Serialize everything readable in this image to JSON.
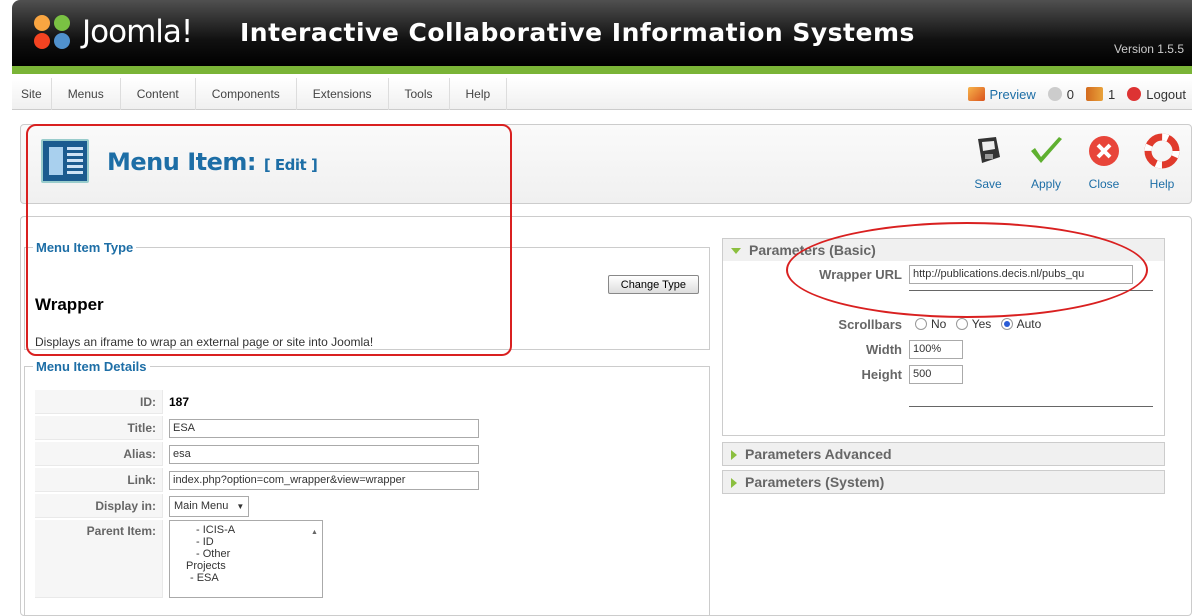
{
  "header": {
    "logo_text": "Joomla!",
    "logo_sup": "®",
    "site_title": "Interactive Collaborative Information Systems",
    "version": "Version 1.5.5"
  },
  "menu": {
    "items": [
      "Site",
      "Menus",
      "Content",
      "Components",
      "Extensions",
      "Tools",
      "Help"
    ]
  },
  "status": {
    "preview": "Preview",
    "messages": "0",
    "users": "1",
    "logout": "Logout"
  },
  "toolbar": {
    "title": "Menu Item:",
    "subtitle": "[ Edit ]",
    "buttons": {
      "save": "Save",
      "apply": "Apply",
      "close": "Close",
      "help": "Help"
    }
  },
  "menu_item_type": {
    "legend": "Menu Item Type",
    "change_type": "Change Type",
    "name": "Wrapper",
    "description": "Displays an iframe to wrap an external page or site into Joomla!"
  },
  "details": {
    "legend": "Menu Item Details",
    "id_label": "ID:",
    "id_value": "187",
    "title_label": "Title:",
    "title_value": "ESA",
    "alias_label": "Alias:",
    "alias_value": "esa",
    "link_label": "Link:",
    "link_value": "index.php?option=com_wrapper&view=wrapper",
    "display_label": "Display in:",
    "display_value": "Main Menu",
    "parent_label": "Parent Item:",
    "parent_items": [
      "- ICIS-A",
      "- ID",
      "- Other",
      "Projects",
      "- ESA"
    ]
  },
  "params_basic": {
    "title": "Parameters (Basic)",
    "wrapper_url_label": "Wrapper URL",
    "wrapper_url_value": "http://publications.decis.nl/pubs_qu",
    "scrollbars_label": "Scrollbars",
    "scroll_no": "No",
    "scroll_yes": "Yes",
    "scroll_auto": "Auto",
    "scroll_selected": "Auto",
    "width_label": "Width",
    "width_value": "100%",
    "height_label": "Height",
    "height_value": "500"
  },
  "params_advanced": {
    "title": "Parameters Advanced"
  },
  "params_system": {
    "title": "Parameters (System)"
  },
  "colors": {
    "header_bg": "#000000",
    "green_bar": "#7ab437",
    "link_blue": "#1d6ea6",
    "annotation_red": "#d92020"
  }
}
